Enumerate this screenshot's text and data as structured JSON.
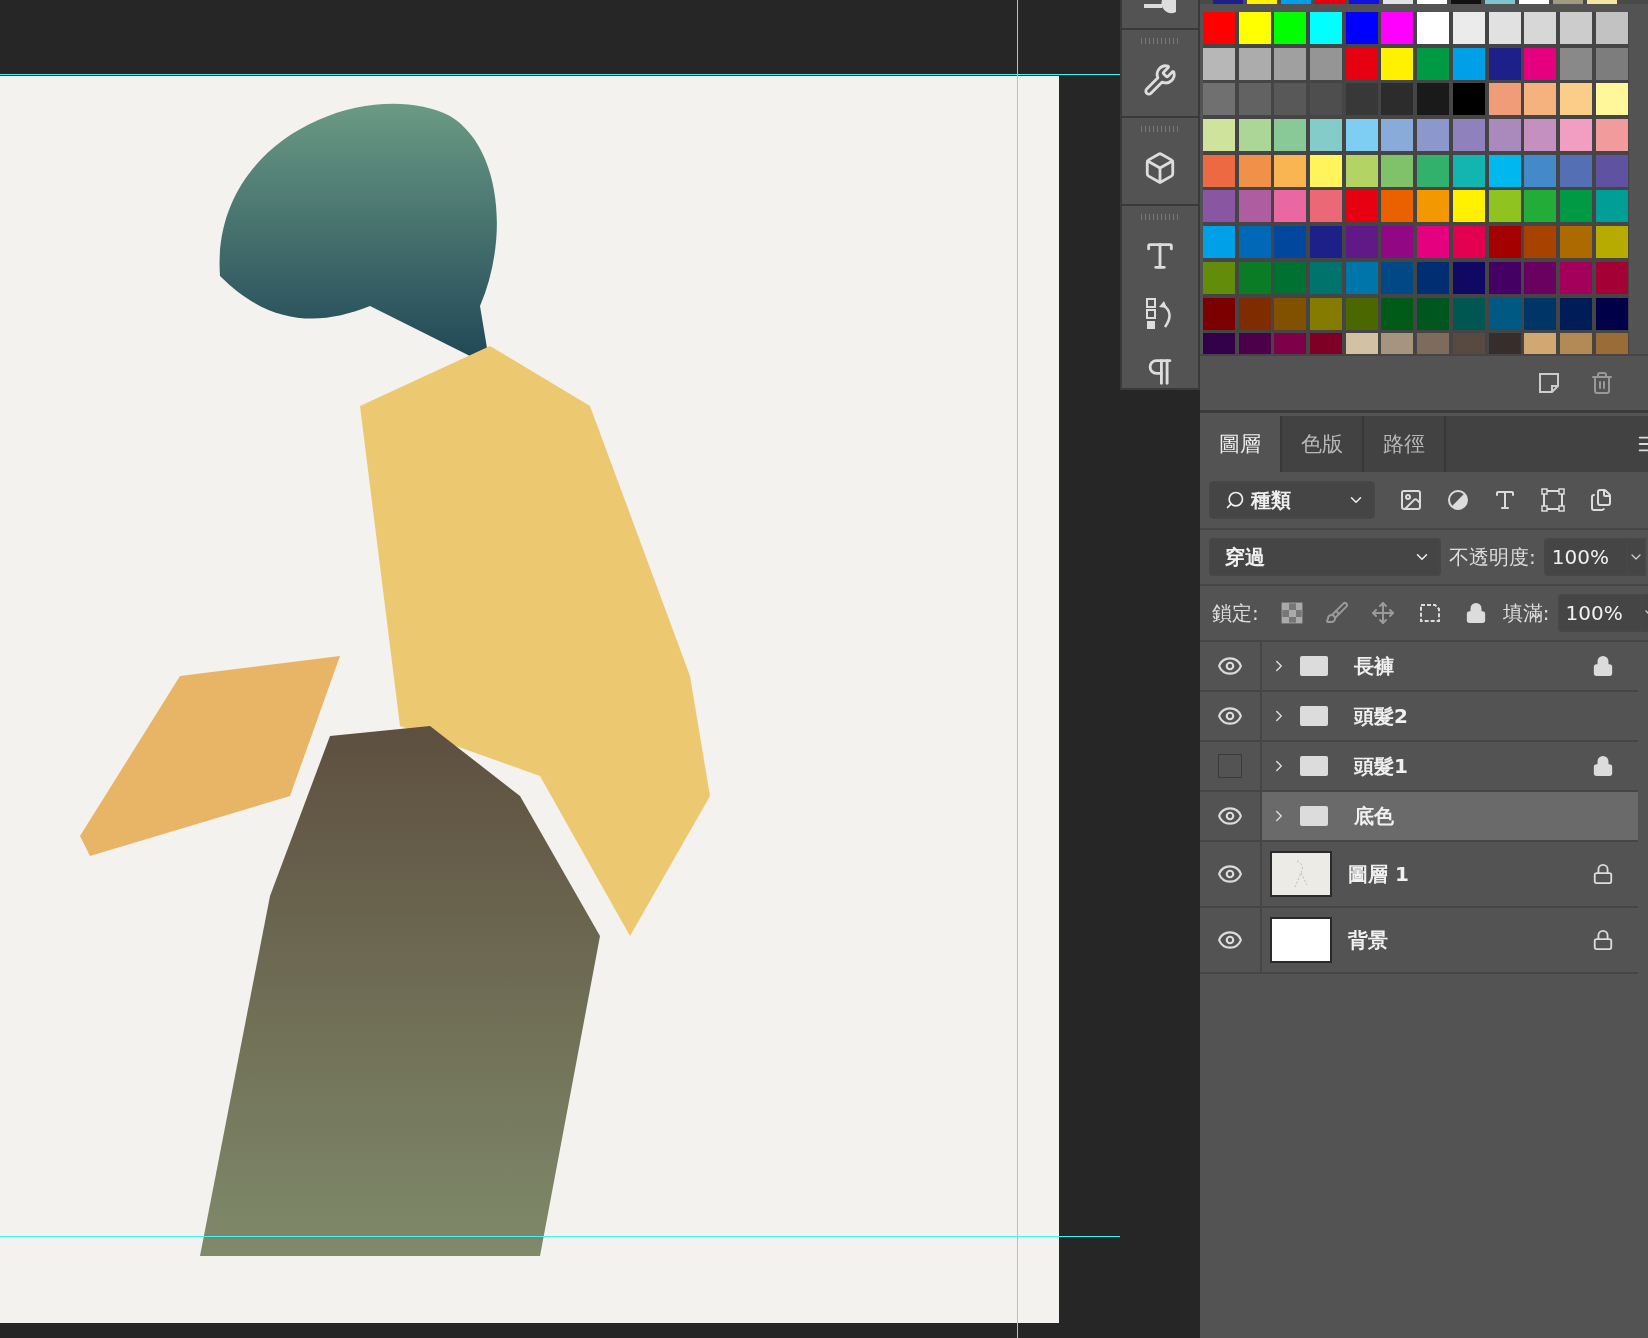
{
  "recent_swatches": [
    {
      "color": "#1d2088"
    },
    {
      "color": "#fff100"
    },
    {
      "color": "#00a0e9"
    },
    {
      "color": "#e60012"
    },
    {
      "color": "#1010e0"
    },
    {
      "color": "#e2e2ea"
    },
    {
      "color": "#ffffff"
    },
    {
      "color": "#111111"
    },
    {
      "color": "#7fc4cc"
    },
    {
      "color": "#ffffff"
    },
    {
      "color": "#a09a80"
    },
    {
      "color": "#f5e6a0"
    }
  ],
  "swatches": [
    {
      "color": "#ff0000"
    },
    {
      "color": "#ffff00"
    },
    {
      "color": "#00ff00"
    },
    {
      "color": "#00ffff"
    },
    {
      "color": "#0000ff"
    },
    {
      "color": "#ff00ff"
    },
    {
      "color": "#ffffff"
    },
    {
      "color": "#ebebeb"
    },
    {
      "color": "#e1e1e1"
    },
    {
      "color": "#d7d7d7"
    },
    {
      "color": "#cccccc"
    },
    {
      "color": "#c2c2c2"
    },
    {
      "color": "#b7b7b7"
    },
    {
      "color": "#acacac"
    },
    {
      "color": "#a0a0a0"
    },
    {
      "color": "#959595"
    },
    {
      "color": "#e60012"
    },
    {
      "color": "#fff100"
    },
    {
      "color": "#009944"
    },
    {
      "color": "#00a0e9"
    },
    {
      "color": "#1d2088"
    },
    {
      "color": "#e4007f"
    },
    {
      "color": "#898989"
    },
    {
      "color": "#7d7d7d"
    },
    {
      "color": "#707070"
    },
    {
      "color": "#626262"
    },
    {
      "color": "#585858"
    },
    {
      "color": "#4e4e4e"
    },
    {
      "color": "#383838"
    },
    {
      "color": "#2c2c2c"
    },
    {
      "color": "#1a1a1a"
    },
    {
      "color": "#000000"
    },
    {
      "color": "#f19c79"
    },
    {
      "color": "#f5b17e"
    },
    {
      "color": "#facd89"
    },
    {
      "color": "#fff799"
    },
    {
      "color": "#cfe39d"
    },
    {
      "color": "#acd598"
    },
    {
      "color": "#89c997"
    },
    {
      "color": "#84ccc9"
    },
    {
      "color": "#7ecef4"
    },
    {
      "color": "#88abda"
    },
    {
      "color": "#8c97cb"
    },
    {
      "color": "#8f82bc"
    },
    {
      "color": "#aa89bd"
    },
    {
      "color": "#c490bf"
    },
    {
      "color": "#f19ec2"
    },
    {
      "color": "#f29b9c"
    },
    {
      "color": "#ec6941"
    },
    {
      "color": "#f19149"
    },
    {
      "color": "#f8b551"
    },
    {
      "color": "#fff45c"
    },
    {
      "color": "#b3d465"
    },
    {
      "color": "#80c269"
    },
    {
      "color": "#32b16c"
    },
    {
      "color": "#13b5b1"
    },
    {
      "color": "#00b7ee"
    },
    {
      "color": "#448aca"
    },
    {
      "color": "#556fb5"
    },
    {
      "color": "#5f52a0"
    },
    {
      "color": "#8957a1"
    },
    {
      "color": "#ae5da1"
    },
    {
      "color": "#ea68a2"
    },
    {
      "color": "#eb6877"
    },
    {
      "color": "#e60012"
    },
    {
      "color": "#eb6100"
    },
    {
      "color": "#f39800"
    },
    {
      "color": "#fff100"
    },
    {
      "color": "#8fc31f"
    },
    {
      "color": "#22ac38"
    },
    {
      "color": "#009944"
    },
    {
      "color": "#009e96"
    },
    {
      "color": "#00a0e9"
    },
    {
      "color": "#0068b7"
    },
    {
      "color": "#00479d"
    },
    {
      "color": "#1d2088"
    },
    {
      "color": "#601986"
    },
    {
      "color": "#920783"
    },
    {
      "color": "#e4007f"
    },
    {
      "color": "#e5004f"
    },
    {
      "color": "#a40000"
    },
    {
      "color": "#a84200"
    },
    {
      "color": "#ac6a00"
    },
    {
      "color": "#b7aa00"
    },
    {
      "color": "#638c0b"
    },
    {
      "color": "#097c25"
    },
    {
      "color": "#007130"
    },
    {
      "color": "#00736d"
    },
    {
      "color": "#0075a9"
    },
    {
      "color": "#004986"
    },
    {
      "color": "#002e73"
    },
    {
      "color": "#100964"
    },
    {
      "color": "#440062"
    },
    {
      "color": "#6a005f"
    },
    {
      "color": "#a4005b"
    },
    {
      "color": "#a40035"
    },
    {
      "color": "#7d0000"
    },
    {
      "color": "#7f2d00"
    },
    {
      "color": "#815100"
    },
    {
      "color": "#847b00"
    },
    {
      "color": "#4a6700"
    },
    {
      "color": "#005b19"
    },
    {
      "color": "#00561f"
    },
    {
      "color": "#005752"
    },
    {
      "color": "#005982"
    },
    {
      "color": "#003567"
    },
    {
      "color": "#001c58"
    },
    {
      "color": "#000049"
    },
    {
      "color": "#33004a"
    },
    {
      "color": "#4b0049"
    },
    {
      "color": "#7e0049"
    },
    {
      "color": "#7f0024"
    },
    {
      "color": "#d3c1a4"
    },
    {
      "color": "#a59580"
    },
    {
      "color": "#7d6b5c"
    },
    {
      "color": "#594a41"
    },
    {
      "color": "#362e2b"
    },
    {
      "color": "#d1a86f"
    },
    {
      "color": "#b38a55"
    },
    {
      "color": "#9a6c38"
    }
  ],
  "layers_panel": {
    "tabs": [
      {
        "label": "圖層",
        "selected": true
      },
      {
        "label": "色版",
        "selected": false
      },
      {
        "label": "路徑",
        "selected": false
      }
    ],
    "filter": {
      "value": "種類"
    },
    "blend_mode": {
      "value": "穿過"
    },
    "opacity": {
      "label": "不透明度:",
      "value": "100%"
    },
    "lock": {
      "label": "鎖定:"
    },
    "fill": {
      "label": "填滿:",
      "value": "100%"
    },
    "layers": [
      {
        "name": "長褲",
        "kind": "group",
        "visible": true,
        "locked": true,
        "selected": false
      },
      {
        "name": "頭髮2",
        "kind": "group",
        "visible": true,
        "locked": false,
        "selected": false
      },
      {
        "name": "頭髮1",
        "kind": "group",
        "visible": false,
        "locked": true,
        "selected": false
      },
      {
        "name": "底色",
        "kind": "group",
        "visible": true,
        "locked": false,
        "selected": true
      },
      {
        "name": "圖層 1",
        "kind": "drawing",
        "visible": true,
        "locked": true,
        "selected": false
      },
      {
        "name": "背景",
        "kind": "background",
        "visible": true,
        "locked": true,
        "selected": false
      }
    ]
  }
}
